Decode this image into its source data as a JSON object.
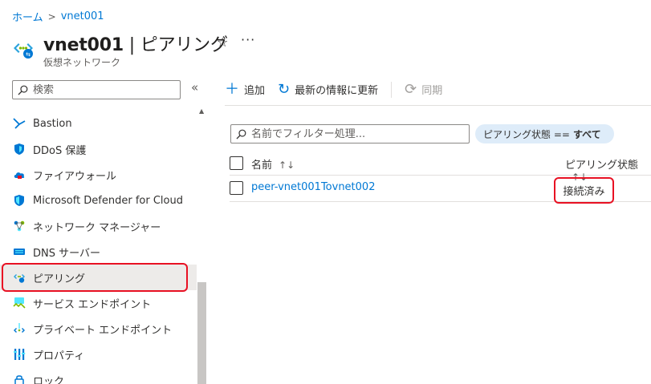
{
  "breadcrumb": {
    "home": "ホーム",
    "current": "vnet001"
  },
  "header": {
    "resource_name": "vnet001",
    "page_name": "ピアリング",
    "separator": " | ",
    "subtitle": "仮想ネットワーク",
    "more": "···"
  },
  "sidebar": {
    "search_placeholder": "検索",
    "collapse": "«",
    "items": [
      {
        "label": "Bastion",
        "icon": "bastion-icon"
      },
      {
        "label": "DDoS 保護",
        "icon": "shield-icon"
      },
      {
        "label": "ファイアウォール",
        "icon": "firewall-icon"
      },
      {
        "label": "Microsoft Defender for Cloud",
        "icon": "defender-icon"
      },
      {
        "label": "ネットワーク マネージャー",
        "icon": "network-manager-icon"
      },
      {
        "label": "DNS サーバー",
        "icon": "dns-icon"
      },
      {
        "label": "ピアリング",
        "icon": "peering-icon",
        "active": true
      },
      {
        "label": "サービス エンドポイント",
        "icon": "service-endpoint-icon"
      },
      {
        "label": "プライベート エンドポイント",
        "icon": "private-endpoint-icon"
      },
      {
        "label": "プロパティ",
        "icon": "properties-icon"
      },
      {
        "label": "ロック",
        "icon": "lock-icon"
      }
    ]
  },
  "toolbar": {
    "add": "追加",
    "refresh": "最新の情報に更新",
    "sync": "同期"
  },
  "filter": {
    "placeholder": "名前でフィルター処理...",
    "pill_label": "ピアリング状態 ==",
    "pill_value": "すべて"
  },
  "table": {
    "columns": {
      "name": "名前",
      "state": "ピアリング状態",
      "sort": "↑↓"
    },
    "rows": [
      {
        "name": "peer-vnet001Tovnet002",
        "state": "接続済み"
      }
    ]
  },
  "colors": {
    "accent": "#0078d4",
    "highlight": "#e81123",
    "pill_bg": "#deecf9"
  }
}
